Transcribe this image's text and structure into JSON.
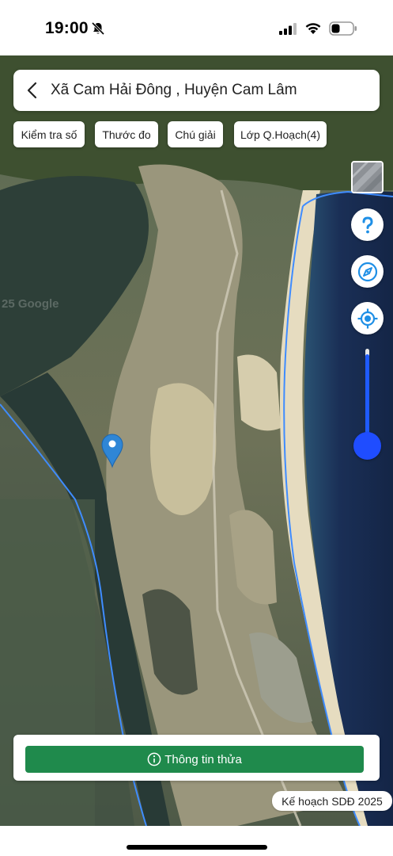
{
  "status_bar": {
    "time": "19:00",
    "icons": [
      "bell-slash-icon",
      "cellular-signal-icon",
      "wifi-icon",
      "battery-icon"
    ]
  },
  "header": {
    "back_icon": "chevron-left-icon",
    "title": "Xã Cam Hải Đông , Huyện Cam Lâm"
  },
  "toolbar": {
    "chips": [
      {
        "label": "Kiểm tra số"
      },
      {
        "label": "Thước đo"
      },
      {
        "label": "Chú giải"
      },
      {
        "label": "Lớp Q.Hoạch(4)"
      }
    ]
  },
  "map": {
    "watermark": "25 Google",
    "boundary_color": "#3f8cff",
    "controls": {
      "layer_toggle_icon": "map-layer-thumbnail",
      "help_icon": "question-mark-icon",
      "compass_icon": "compass-icon",
      "locate_icon": "my-location-icon",
      "opacity_level": 1.0,
      "accent_color": "#1f4dff"
    },
    "marker_icon": "location-pin-icon"
  },
  "bottom": {
    "info_button_icon": "info-circle-icon",
    "info_button_label": "Thông tin thửa",
    "button_color": "#1f8a4c",
    "plan_badge": "Kế hoạch SDĐ 2025"
  }
}
